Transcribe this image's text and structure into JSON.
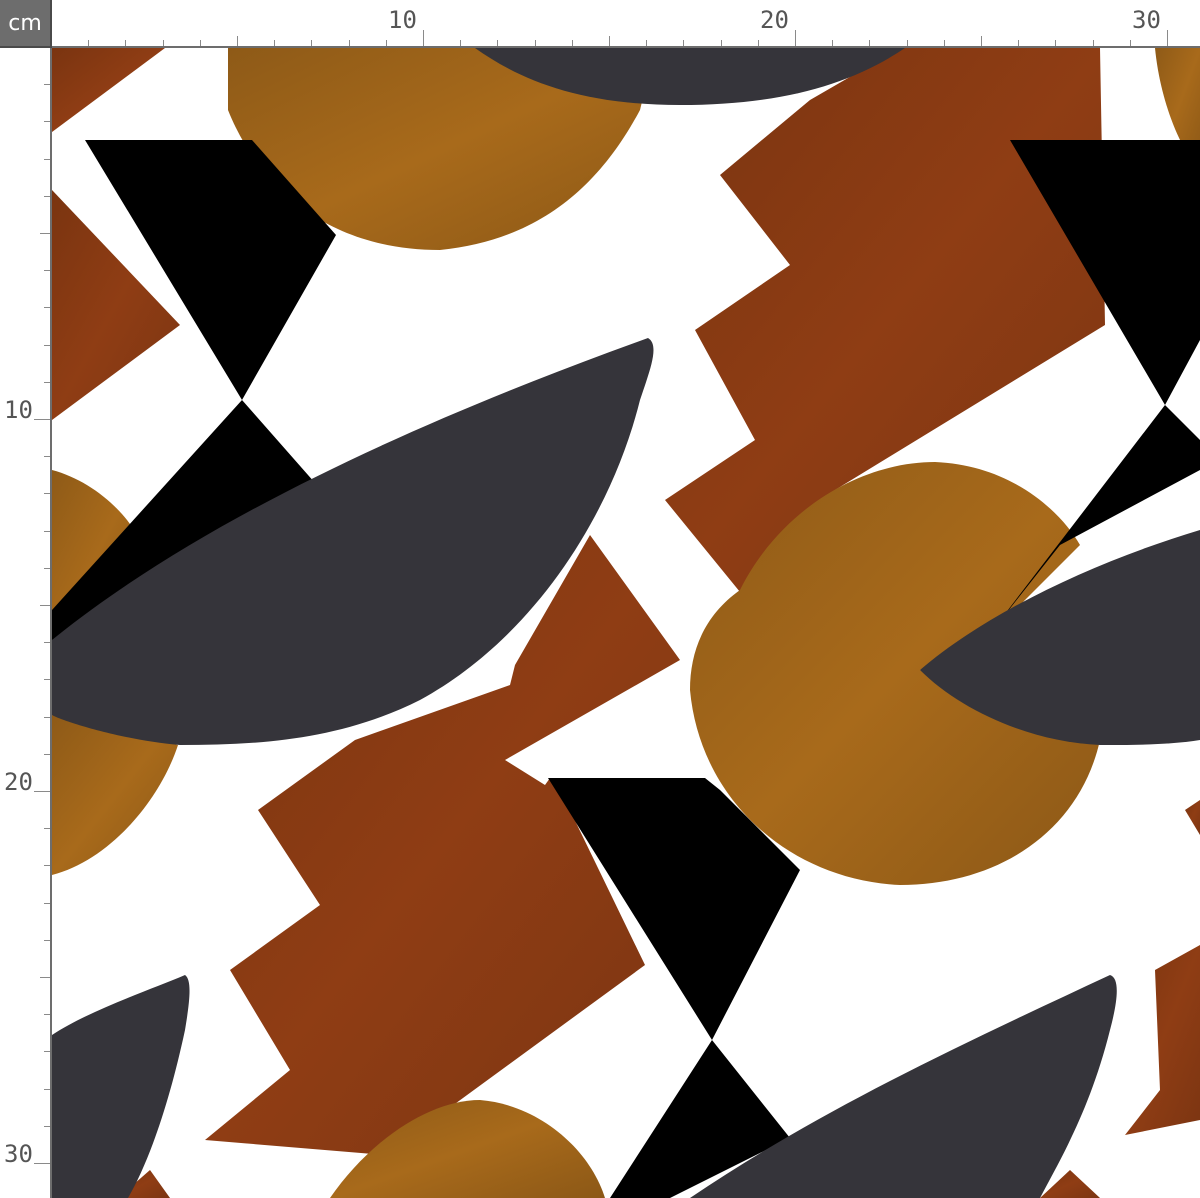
{
  "ruler": {
    "unit_label": "cm",
    "top_labels": [
      "10",
      "20",
      "30"
    ],
    "left_labels": [
      "10",
      "20",
      "30"
    ]
  },
  "palette": {
    "background": "#ffffff",
    "rust": "#8a3a12",
    "ochre": "#a0651a",
    "charcoal": "#35343a",
    "black": "#000000",
    "ruler_corner": "#6d6d6d"
  },
  "pattern": {
    "motifs": [
      "rust-zigzag-block",
      "ochre-half-circle",
      "charcoal-half-moon",
      "black-hourglass"
    ]
  }
}
